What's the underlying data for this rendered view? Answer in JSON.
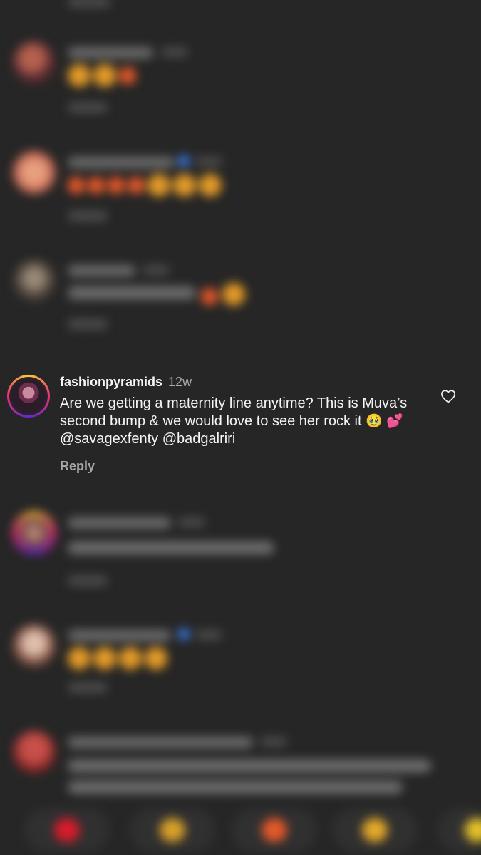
{
  "comment": {
    "username": "fashionpyramids",
    "time": "12w",
    "text": "Are we getting a maternity line anytime? This is Muva’s second bump & we would love to see her rock it",
    "emojis": "🥹 💕",
    "mentions": "@savagexfenty @badgalriri",
    "reply_label": "Reply"
  },
  "icons": {
    "like": "heart-outline-icon"
  },
  "colors": {
    "background": "#262626",
    "primary_text": "#f5f5f5",
    "secondary_text": "#a8a8a8"
  },
  "quick_reactions": [
    "❤️",
    "🙌",
    "🔥",
    "👏",
    "😢"
  ]
}
